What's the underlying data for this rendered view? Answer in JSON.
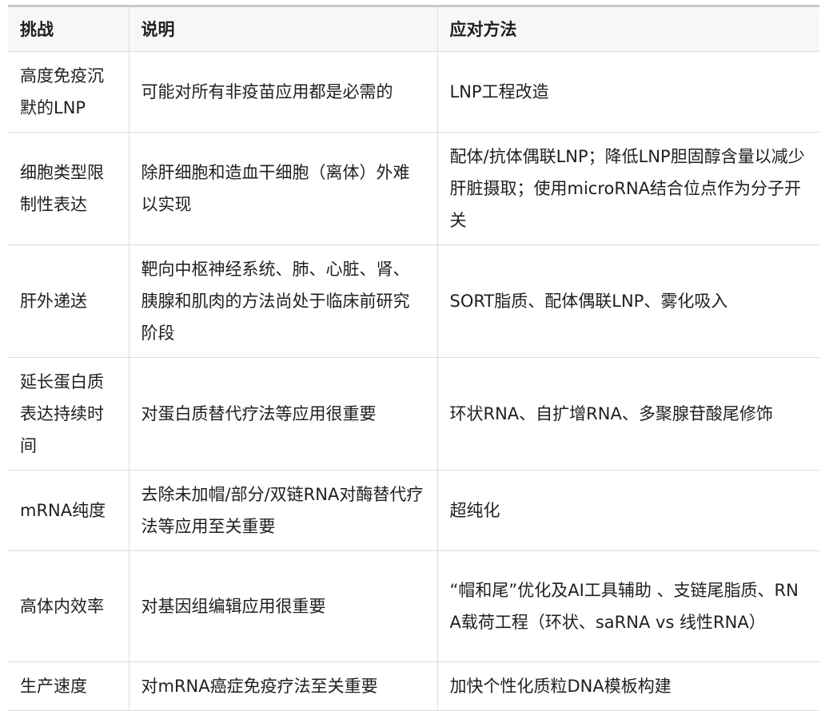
{
  "table": {
    "headers": [
      "挑战",
      "说明",
      "应对方法"
    ],
    "rows": [
      {
        "challenge": "高度免疫沉默的LNP",
        "description": "可能对所有非疫苗应用都是必需的",
        "solution": "LNP工程改造"
      },
      {
        "challenge": "细胞类型限制性表达",
        "description": "除肝细胞和造血干细胞（离体）外难以实现",
        "solution": "配体/抗体偶联LNP；降低LNP胆固醇含量以减少肝脏摄取；使用microRNA结合位点作为分子开关"
      },
      {
        "challenge": "肝外递送",
        "description": "靶向中枢神经系统、肺、心脏、肾、胰腺和肌肉的方法尚处于临床前研究阶段",
        "solution": "SORT脂质、配体偶联LNP、雾化吸入"
      },
      {
        "challenge": "延长蛋白质表达持续时间",
        "description": "对蛋白质替代疗法等应用很重要",
        "solution": "环状RNA、自扩增RNA、多聚腺苷酸尾修饰"
      },
      {
        "challenge": "mRNA纯度",
        "description": "去除未加帽/部分/双链RNA对酶替代疗法等应用至关重要",
        "solution": "超纯化"
      },
      {
        "challenge": "高体内效率",
        "description": "对基因组编辑应用很重要",
        "solution": "“帽和尾”优化及AI工具辅助 、支链尾脂质、RNA载荷工程（环状、saRNA vs 线性RNA）"
      },
      {
        "challenge": "生产速度",
        "description": "对mRNA癌症免疫疗法至关重要",
        "solution": "加快个性化质粒DNA模板构建"
      }
    ]
  }
}
